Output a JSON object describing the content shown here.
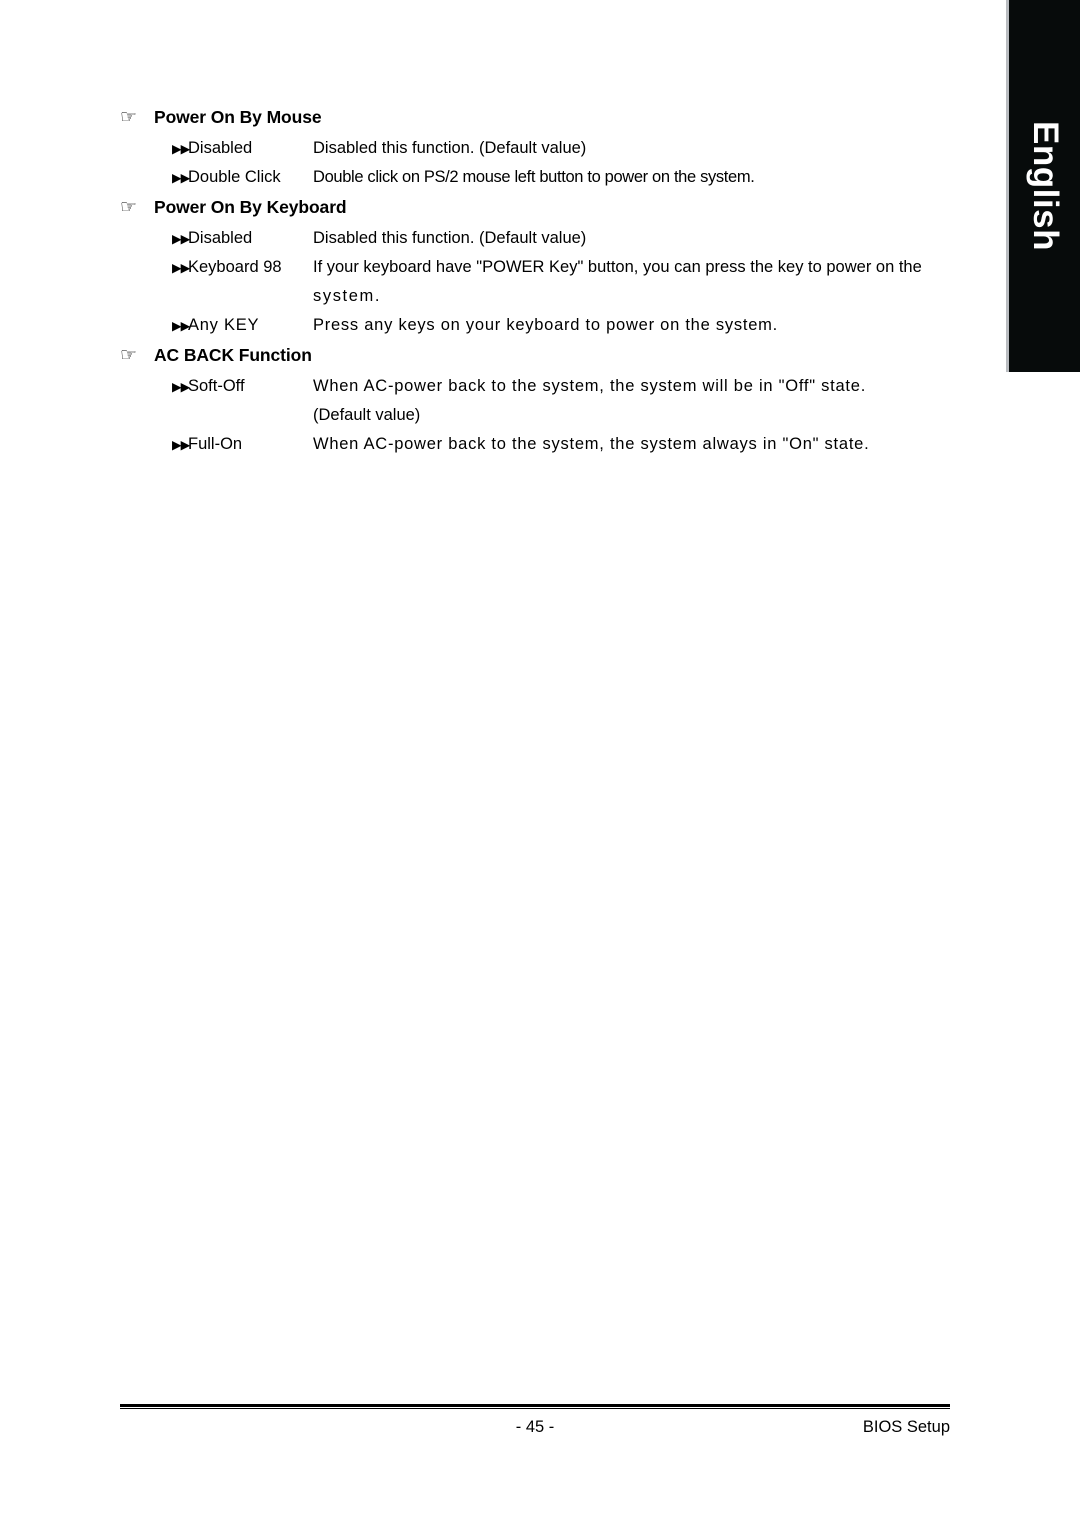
{
  "page": {
    "language_tab": "English",
    "hand_icon_glyph": "☞",
    "bullet_glyph": "▶▶"
  },
  "sections": [
    {
      "title": "Power On By Mouse",
      "options": [
        {
          "label": "Disabled",
          "desc": "Disabled this function. (Default value)",
          "continuations": []
        },
        {
          "label": "Double Click",
          "desc": "Double click on PS/2 mouse left button to power on the system.",
          "continuations": []
        }
      ]
    },
    {
      "title": "Power On By Keyboard",
      "options": [
        {
          "label": "Disabled",
          "desc": "Disabled this function. (Default value)",
          "continuations": []
        },
        {
          "label": "Keyboard 98",
          "desc": "If your keyboard have \"POWER Key\" button, you can press the key to power on the",
          "continuations": [
            "system."
          ]
        },
        {
          "label": "Any KEY",
          "desc": "Press any keys on your keyboard to power on the system.",
          "continuations": []
        }
      ]
    },
    {
      "title": "AC BACK Function",
      "options": [
        {
          "label": "Soft-Off",
          "desc": "When AC-power back to the system, the system will be in \"Off\" state.",
          "continuations": [
            "(Default value)"
          ]
        },
        {
          "label": "Full-On",
          "desc": "When AC-power back to the system, the system always in \"On\" state.",
          "continuations": []
        }
      ]
    }
  ],
  "footer": {
    "page_number": "- 45 -",
    "right_label": "BIOS Setup"
  }
}
